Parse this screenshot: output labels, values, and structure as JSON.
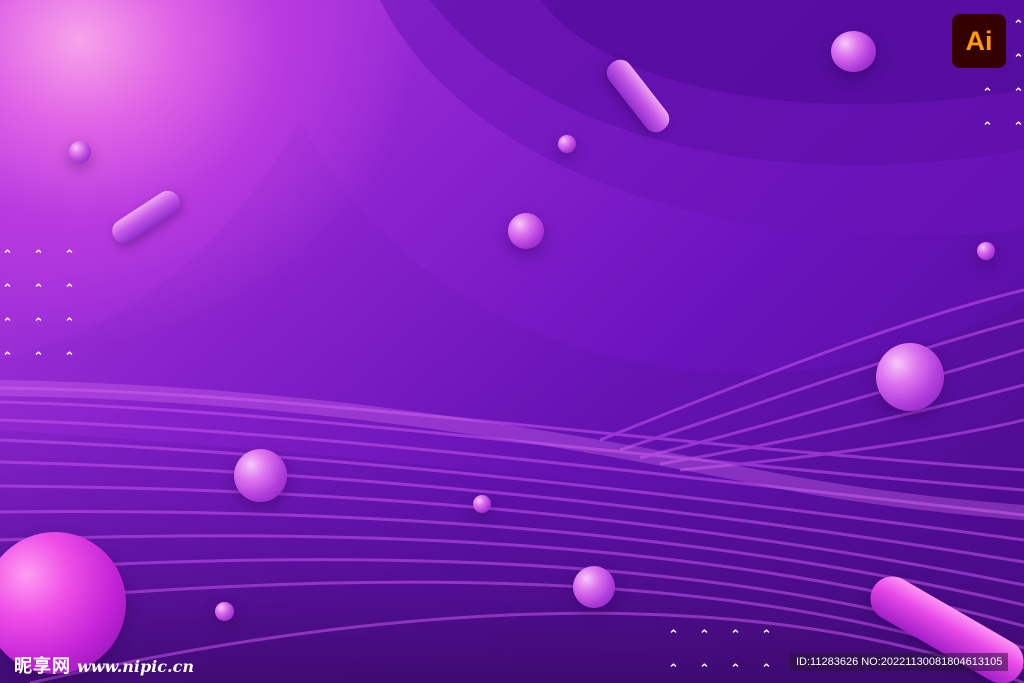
{
  "badge": {
    "label": "Ai",
    "background_color": "#330000",
    "text_color": "#ff9a00"
  },
  "watermark": {
    "site_name": "昵享网",
    "site_url": "www.nipic.cn",
    "id_text": "ID:11283626 NO:20221130081804613105"
  },
  "decor": {
    "chevron_glyph": "⌃",
    "palette": [
      "#f7a3ea",
      "#b43fe0",
      "#6a13bd",
      "#3d0a6e"
    ]
  }
}
